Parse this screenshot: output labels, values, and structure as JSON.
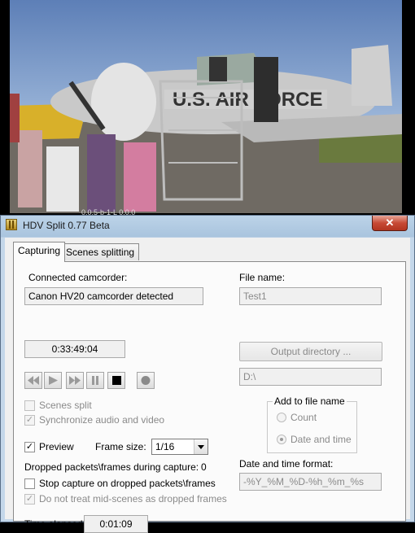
{
  "window": {
    "title": "HDV Split 0.77 Beta",
    "close_glyph": "✕"
  },
  "tabs": [
    {
      "label": "Capturing"
    },
    {
      "label": "Scenes splitting"
    }
  ],
  "capturing": {
    "connected_camcorder_label": "Connected camcorder:",
    "camcorder_status": "Canon HV20 camcorder detected",
    "timecode": "0:33:49:04",
    "transport_icons": [
      "rewind-icon",
      "play-icon",
      "fast-forward-icon",
      "pause-icon",
      "stop-icon",
      "record-icon"
    ],
    "scenes_split_label": "Scenes split",
    "sync_audio_video_label": "Synchronize audio and video",
    "preview_label": "Preview",
    "frame_size_label": "Frame size:",
    "frame_size_value": "1/16",
    "dropped_label": "Dropped packets\\frames during capture:",
    "dropped_value": "0",
    "stop_on_dropped_label": "Stop capture on dropped packets\\frames",
    "mid_scenes_label": "Do not treat mid-scenes as dropped frames",
    "time_elapsed_label": "Time elapsed:",
    "time_elapsed_value": "0:01:09"
  },
  "file": {
    "file_name_label": "File name:",
    "file_name_value": "Test1",
    "output_directory_button": "Output directory ...",
    "output_directory_value": "D:\\",
    "add_to_file_name_label": "Add to file name",
    "count_label": "Count",
    "date_time_label": "Date and time",
    "date_time_format_label": "Date and time format:",
    "date_time_format_value": "-%Y_%M_%D-%h_%m_%s"
  },
  "preview_overlay_text": "0.0.5-b-1-L       0.0.0"
}
